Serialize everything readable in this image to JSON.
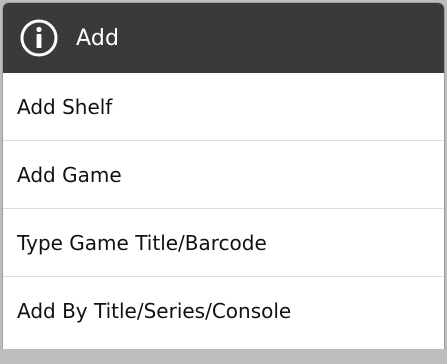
{
  "dialog": {
    "title": "Add",
    "icon": "info-icon",
    "colors": {
      "header_bg": "#3a3a3a",
      "header_text": "#ffffff",
      "item_text": "#111111",
      "divider": "#dcdcdc"
    }
  },
  "menu": {
    "items": [
      {
        "label": "Add Shelf"
      },
      {
        "label": "Add Game"
      },
      {
        "label": "Type Game Title/Barcode"
      },
      {
        "label": "Add By Title/Series/Console"
      }
    ]
  }
}
